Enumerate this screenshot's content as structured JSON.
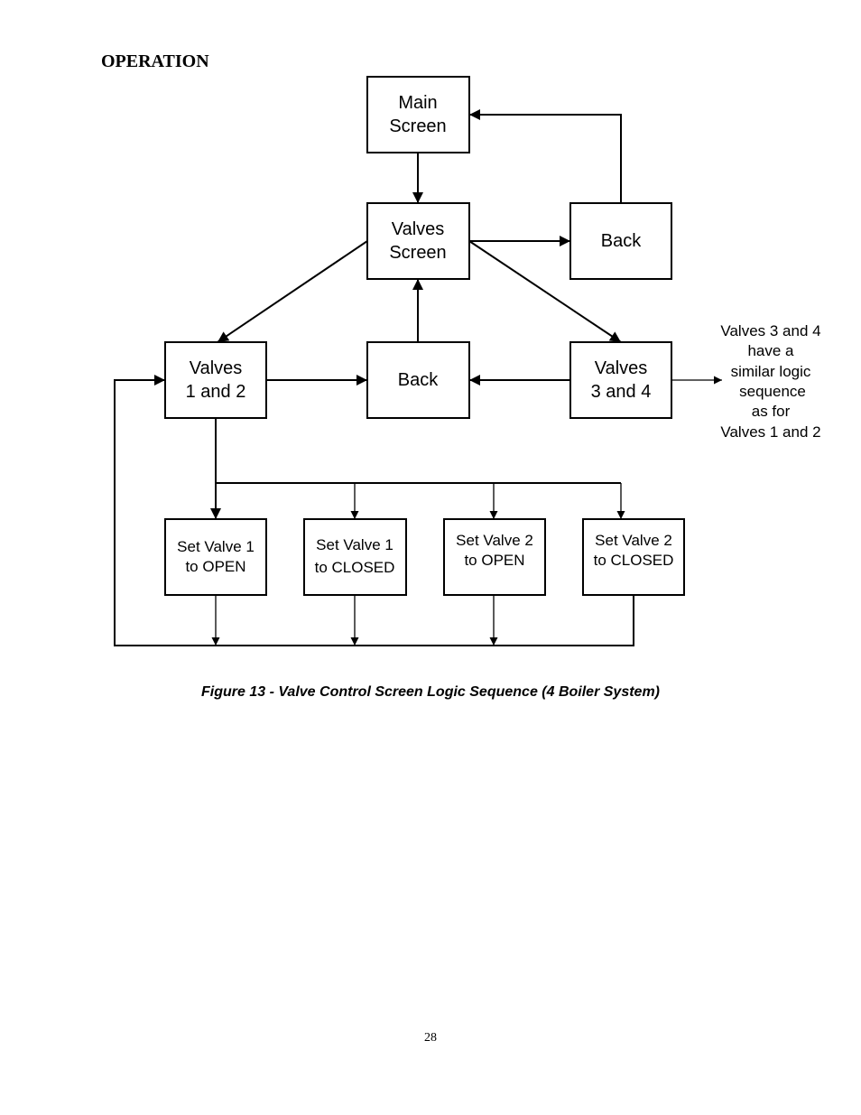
{
  "document": {
    "section_title": "OPERATION",
    "caption": "Figure 13 - Valve Control Screen Logic Sequence (4 Boiler System)",
    "page_number": "28"
  },
  "diagram": {
    "nodes": {
      "main_screen": [
        "Main",
        "Screen"
      ],
      "valves_screen": [
        "Valves",
        "Screen"
      ],
      "back_top": [
        "Back"
      ],
      "valves_1_2": [
        "Valves",
        "1 and 2"
      ],
      "back_mid": [
        "Back"
      ],
      "valves_3_4": [
        "Valves",
        "3 and 4"
      ],
      "set_v1_open": [
        "Set Valve 1",
        "to OPEN"
      ],
      "set_v1_closed": [
        "Set Valve 1",
        "to CLOSED"
      ],
      "set_v2_open": [
        "Set Valve 2",
        "to OPEN"
      ],
      "set_v2_closed": [
        "Set Valve 2",
        "to CLOSED"
      ]
    },
    "note": [
      "Valves 3 and 4",
      "have a",
      "similar logic",
      "sequence",
      "as for",
      "Valves 1 and 2"
    ],
    "edges": [
      {
        "from": "main_screen",
        "to": "valves_screen"
      },
      {
        "from": "valves_screen",
        "to": "back_top"
      },
      {
        "from": "back_top",
        "to": "main_screen"
      },
      {
        "from": "valves_screen",
        "to": "valves_1_2"
      },
      {
        "from": "valves_screen",
        "to": "valves_3_4"
      },
      {
        "from": "back_mid",
        "to": "valves_screen"
      },
      {
        "from": "valves_1_2",
        "to": "back_mid"
      },
      {
        "from": "valves_3_4",
        "to": "back_mid"
      },
      {
        "from": "valves_3_4",
        "to": "note"
      },
      {
        "from": "valves_1_2",
        "to": "set_v1_open"
      },
      {
        "from": "valves_1_2",
        "to": "set_v1_closed"
      },
      {
        "from": "valves_1_2",
        "to": "set_v2_open"
      },
      {
        "from": "valves_1_2",
        "to": "set_v2_closed"
      },
      {
        "from": "set_v1_open",
        "to": "valves_1_2"
      },
      {
        "from": "set_v1_closed",
        "to": "valves_1_2"
      },
      {
        "from": "set_v2_open",
        "to": "valves_1_2"
      },
      {
        "from": "set_v2_closed",
        "to": "valves_1_2"
      }
    ]
  }
}
